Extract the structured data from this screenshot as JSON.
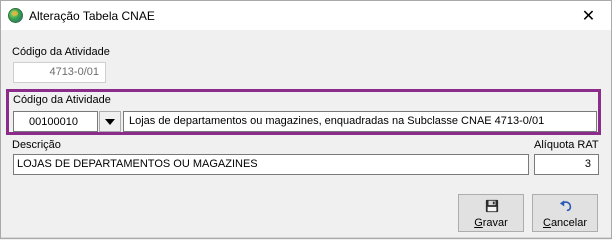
{
  "window": {
    "title": "Alteração Tabela CNAE",
    "close_glyph": "✕"
  },
  "form": {
    "atividade_top_label": "Código da Atividade",
    "atividade_top_value": "4713-0/01",
    "atividade_label": "Código da Atividade",
    "atividade_code": "00100010",
    "atividade_description": "Lojas de departamentos ou magazines, enquadradas na Subclasse CNAE 4713-0/01",
    "descricao_label": "Descrição",
    "descricao_value": "LOJAS DE DEPARTAMENTOS OU MAGAZINES",
    "aliquota_label": "Alíquota RAT",
    "aliquota_value": "3"
  },
  "buttons": {
    "gravar_mnemonic": "G",
    "gravar_rest": "ravar",
    "cancelar_mnemonic": "C",
    "cancelar_rest": "ancelar"
  },
  "colors": {
    "highlight": "#8b2c8b"
  },
  "icons": {
    "app": "cnae-app-icon",
    "save": "floppy-disk-icon",
    "cancel": "undo-arrow-icon"
  }
}
